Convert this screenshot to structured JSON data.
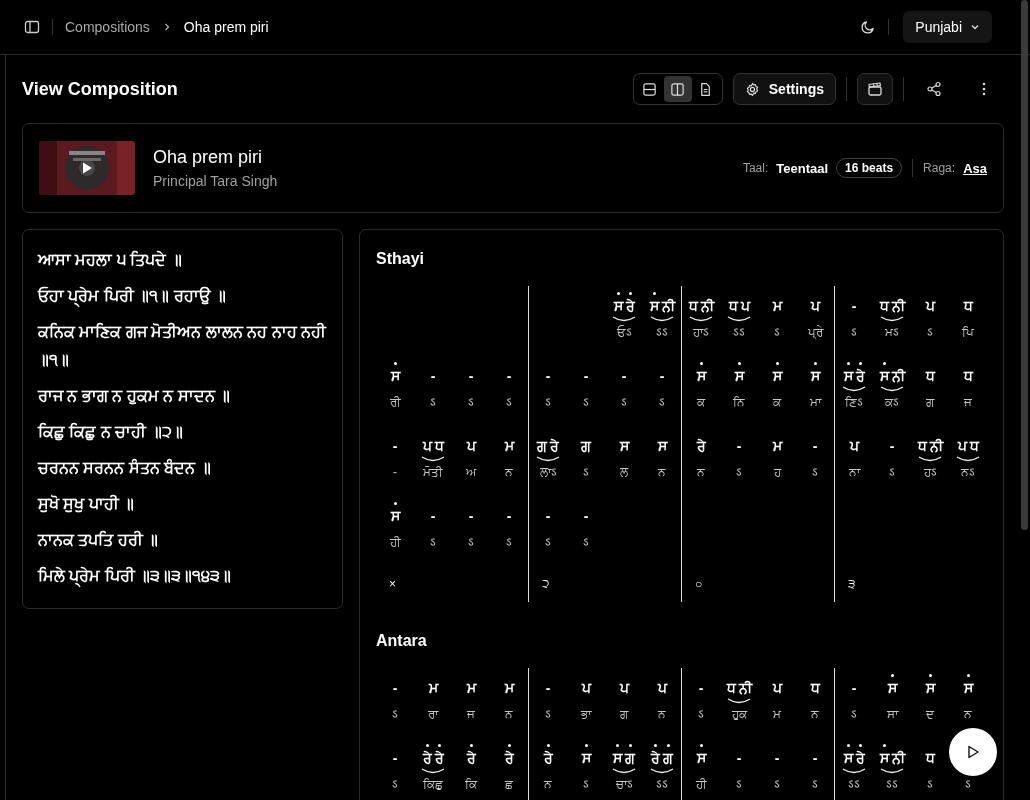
{
  "breadcrumb": [
    "Compositions",
    "Oha prem piri"
  ],
  "language": "Punjabi",
  "page_title": "View Composition",
  "view_modes": [
    {
      "kind": "rows",
      "selected": false
    },
    {
      "kind": "columns",
      "selected": true
    },
    {
      "kind": "document",
      "selected": false
    }
  ],
  "settings_label": "Settings",
  "composition": {
    "title": "Oha prem piri",
    "artist": "Principal Tara Singh",
    "taal_label": "Taal:",
    "taal": "Teentaal",
    "beats": "16 beats",
    "raga_label": "Raga:",
    "raga": "Asa"
  },
  "lyrics": [
    "ਆਸਾ ਮਹਲਾ ੫ ਤਿਪਦੇ ॥",
    "ਓਹਾ ਪ੍ਰੇਮ ਪਿਰੀ ॥੧॥ ਰਹਾਉ ॥",
    "ਕਨਿਕ ਮਾਣਿਕ ਗਜ ਮੋਤੀਅਨ ਲਾਲਨ ਨਹ ਨਾਹ ਨਹੀ ॥੧॥",
    "ਰਾਜ ਨ ਭਾਗ ਨ ਹੁਕਮ ਨ ਸਾਦਨ ॥",
    "ਕਿਛੁ ਕਿਛੁ ਨ ਚਾਹੀ ॥੨॥",
    "ਚਰਨਨ ਸਰਨਨ ਸੰਤਨ ਬੰਦਨ ॥",
    "ਸੁਖੋ ਸੁਖੁ ਪਾਹੀ ॥",
    "ਨਾਨਕ ਤਪਤਿ ਹਰੀ ॥",
    "ਮਿਲੇ ਪ੍ਰੇਮ ਪਿਰੀ ॥੩॥੩॥੧੪੩॥"
  ],
  "sections": [
    {
      "title": "Sthayi",
      "taal_marks": [
        "×",
        "੨",
        "○",
        "੩"
      ],
      "rows": [
        [
          {
            "kind": "empty"
          },
          {
            "kind": "empty"
          },
          {
            "kind": "empty"
          },
          {
            "kind": "empty"
          },
          {
            "kind": "empty"
          },
          {
            "kind": "empty"
          },
          {
            "kind": "note",
            "notes": [
              {
                "text": "ਸ",
                "upper": true
              },
              {
                "text": "ਰੇ",
                "upper": true
              }
            ],
            "lyric": "ਓऽ"
          },
          {
            "kind": "note",
            "notes": [
              {
                "text": "ਸ",
                "upper": true
              },
              {
                "text": "ਨੀ",
                "upper": false
              }
            ],
            "lyric": "ऽऽ"
          },
          {
            "kind": "note",
            "notes": [
              {
                "text": "ਧ",
                "upper": false
              },
              {
                "text": "ਨੀ",
                "upper": false
              }
            ],
            "lyric": "ਹਾऽ"
          },
          {
            "kind": "note",
            "notes": [
              {
                "text": "ਧ",
                "upper": false
              },
              {
                "text": "ਪ",
                "upper": false
              }
            ],
            "lyric": "ऽऽ"
          },
          {
            "kind": "note",
            "notes": [
              {
                "text": "ਮ",
                "upper": false
              }
            ],
            "lyric": "ऽ"
          },
          {
            "kind": "note",
            "notes": [
              {
                "text": "ਪ",
                "upper": false
              }
            ],
            "lyric": "ਪ੍ਰੇ"
          },
          {
            "kind": "note",
            "notes": [
              {
                "text": "-",
                "upper": false
              }
            ],
            "lyric": "ऽ"
          },
          {
            "kind": "note",
            "notes": [
              {
                "text": "ਧ",
                "upper": false
              },
              {
                "text": "ਨੀ",
                "upper": false
              }
            ],
            "lyric": "ਮऽ"
          },
          {
            "kind": "note",
            "notes": [
              {
                "text": "ਪ",
                "upper": false
              }
            ],
            "lyric": "ऽ"
          },
          {
            "kind": "note",
            "notes": [
              {
                "text": "ਧ",
                "upper": false
              }
            ],
            "lyric": "ਪਿ"
          }
        ],
        [
          {
            "kind": "note",
            "notes": [
              {
                "text": "ਸ",
                "upper": true
              }
            ],
            "lyric": "ਰੀ"
          },
          {
            "kind": "note",
            "notes": [
              {
                "text": "-",
                "upper": false
              }
            ],
            "lyric": "ऽ"
          },
          {
            "kind": "note",
            "notes": [
              {
                "text": "-",
                "upper": false
              }
            ],
            "lyric": "ऽ"
          },
          {
            "kind": "note",
            "notes": [
              {
                "text": "-",
                "upper": false
              }
            ],
            "lyric": "ऽ"
          },
          {
            "kind": "note",
            "notes": [
              {
                "text": "-",
                "upper": false
              }
            ],
            "lyric": "ऽ"
          },
          {
            "kind": "note",
            "notes": [
              {
                "text": "-",
                "upper": false
              }
            ],
            "lyric": "ऽ"
          },
          {
            "kind": "note",
            "notes": [
              {
                "text": "-",
                "upper": false
              }
            ],
            "lyric": "ऽ"
          },
          {
            "kind": "note",
            "notes": [
              {
                "text": "-",
                "upper": false
              }
            ],
            "lyric": "ऽ"
          },
          {
            "kind": "note",
            "notes": [
              {
                "text": "ਸ",
                "upper": true
              }
            ],
            "lyric": "ਕ"
          },
          {
            "kind": "note",
            "notes": [
              {
                "text": "ਸ",
                "upper": true
              }
            ],
            "lyric": "ਨਿ"
          },
          {
            "kind": "note",
            "notes": [
              {
                "text": "ਸ",
                "upper": true
              }
            ],
            "lyric": "ਕ"
          },
          {
            "kind": "note",
            "notes": [
              {
                "text": "ਸ",
                "upper": true
              }
            ],
            "lyric": "ਮਾ"
          },
          {
            "kind": "note",
            "notes": [
              {
                "text": "ਸ",
                "upper": true
              },
              {
                "text": "ਰੇ",
                "upper": true
              }
            ],
            "lyric": "ਣਿऽ"
          },
          {
            "kind": "note",
            "notes": [
              {
                "text": "ਸ",
                "upper": true
              },
              {
                "text": "ਨੀ",
                "upper": false
              }
            ],
            "lyric": "ਕऽ"
          },
          {
            "kind": "note",
            "notes": [
              {
                "text": "ਧ",
                "upper": false
              }
            ],
            "lyric": "ਗ"
          },
          {
            "kind": "note",
            "notes": [
              {
                "text": "ਧ",
                "upper": false
              }
            ],
            "lyric": "ਜ"
          }
        ],
        [
          {
            "kind": "note",
            "notes": [
              {
                "text": "-",
                "upper": false
              }
            ],
            "lyric": "-"
          },
          {
            "kind": "note",
            "notes": [
              {
                "text": "ਪ",
                "upper": false
              },
              {
                "text": "ਧ",
                "upper": false
              }
            ],
            "lyric": "ਮੋਤੀ"
          },
          {
            "kind": "note",
            "notes": [
              {
                "text": "ਪ",
                "upper": false
              }
            ],
            "lyric": "ਅ"
          },
          {
            "kind": "note",
            "notes": [
              {
                "text": "ਮ",
                "upper": false
              }
            ],
            "lyric": "ਨ"
          },
          {
            "kind": "note",
            "notes": [
              {
                "text": "ਗ",
                "upper": false
              },
              {
                "text": "ਰੇ",
                "upper": false
              }
            ],
            "lyric": "ਲਾऽ"
          },
          {
            "kind": "note",
            "notes": [
              {
                "text": "ਗ",
                "upper": false
              }
            ],
            "lyric": "ऽ"
          },
          {
            "kind": "note",
            "notes": [
              {
                "text": "ਸ",
                "upper": false
              }
            ],
            "lyric": "ਲ"
          },
          {
            "kind": "note",
            "notes": [
              {
                "text": "ਸ",
                "upper": false
              }
            ],
            "lyric": "ਨ"
          },
          {
            "kind": "note",
            "notes": [
              {
                "text": "ਰੇ",
                "upper": false
              }
            ],
            "lyric": "ਨ"
          },
          {
            "kind": "note",
            "notes": [
              {
                "text": "-",
                "upper": false
              }
            ],
            "lyric": "ऽ"
          },
          {
            "kind": "note",
            "notes": [
              {
                "text": "ਮ",
                "upper": false
              }
            ],
            "lyric": "ਹ"
          },
          {
            "kind": "note",
            "notes": [
              {
                "text": "-",
                "upper": false
              }
            ],
            "lyric": "ऽ"
          },
          {
            "kind": "note",
            "notes": [
              {
                "text": "ਪ",
                "upper": false
              }
            ],
            "lyric": "ਨਾ"
          },
          {
            "kind": "note",
            "notes": [
              {
                "text": "-",
                "upper": false
              }
            ],
            "lyric": "ऽ"
          },
          {
            "kind": "note",
            "notes": [
              {
                "text": "ਧ",
                "upper": false
              },
              {
                "text": "ਨੀ",
                "upper": false
              }
            ],
            "lyric": "ਹऽ"
          },
          {
            "kind": "note",
            "notes": [
              {
                "text": "ਪ",
                "upper": false
              },
              {
                "text": "ਧ",
                "upper": false
              }
            ],
            "lyric": "ਨऽ"
          }
        ],
        [
          {
            "kind": "note",
            "notes": [
              {
                "text": "ਸ",
                "upper": true
              }
            ],
            "lyric": "ਹੀ"
          },
          {
            "kind": "note",
            "notes": [
              {
                "text": "-",
                "upper": false
              }
            ],
            "lyric": "ऽ"
          },
          {
            "kind": "note",
            "notes": [
              {
                "text": "-",
                "upper": false
              }
            ],
            "lyric": "ऽ"
          },
          {
            "kind": "note",
            "notes": [
              {
                "text": "-",
                "upper": false
              }
            ],
            "lyric": "ऽ"
          },
          {
            "kind": "note",
            "notes": [
              {
                "text": "-",
                "upper": false
              }
            ],
            "lyric": "ऽ"
          },
          {
            "kind": "note",
            "notes": [
              {
                "text": "-",
                "upper": false
              }
            ],
            "lyric": "ऽ"
          }
        ]
      ]
    },
    {
      "title": "Antara",
      "rows": [
        [
          {
            "kind": "note",
            "notes": [
              {
                "text": "-",
                "upper": false
              }
            ],
            "lyric": "ऽ"
          },
          {
            "kind": "note",
            "notes": [
              {
                "text": "ਮ",
                "upper": false
              }
            ],
            "lyric": "ਰਾ"
          },
          {
            "kind": "note",
            "notes": [
              {
                "text": "ਮ",
                "upper": false
              }
            ],
            "lyric": "ਜ"
          },
          {
            "kind": "note",
            "notes": [
              {
                "text": "ਮ",
                "upper": false
              }
            ],
            "lyric": "ਨ"
          },
          {
            "kind": "note",
            "notes": [
              {
                "text": "-",
                "upper": false
              }
            ],
            "lyric": "ऽ"
          },
          {
            "kind": "note",
            "notes": [
              {
                "text": "ਪ",
                "upper": false
              }
            ],
            "lyric": "ਭਾ"
          },
          {
            "kind": "note",
            "notes": [
              {
                "text": "ਪ",
                "upper": false
              }
            ],
            "lyric": "ਗ"
          },
          {
            "kind": "note",
            "notes": [
              {
                "text": "ਪ",
                "upper": false
              }
            ],
            "lyric": "ਨ"
          },
          {
            "kind": "note",
            "notes": [
              {
                "text": "-",
                "upper": false
              }
            ],
            "lyric": "ऽ"
          },
          {
            "kind": "note",
            "notes": [
              {
                "text": "ਧ",
                "upper": false
              },
              {
                "text": "ਨੀ",
                "upper": false
              }
            ],
            "lyric": "ਹੁਕ"
          },
          {
            "kind": "note",
            "notes": [
              {
                "text": "ਪ",
                "upper": false
              }
            ],
            "lyric": "ਮ"
          },
          {
            "kind": "note",
            "notes": [
              {
                "text": "ਧ",
                "upper": false
              }
            ],
            "lyric": "ਨ"
          },
          {
            "kind": "note",
            "notes": [
              {
                "text": "-",
                "upper": false
              }
            ],
            "lyric": "ऽ"
          },
          {
            "kind": "note",
            "notes": [
              {
                "text": "ਸ",
                "upper": true
              }
            ],
            "lyric": "ਸਾ"
          },
          {
            "kind": "note",
            "notes": [
              {
                "text": "ਸ",
                "upper": true
              }
            ],
            "lyric": "ਦ"
          },
          {
            "kind": "note",
            "notes": [
              {
                "text": "ਸ",
                "upper": true
              }
            ],
            "lyric": "ਨ"
          }
        ],
        [
          {
            "kind": "note",
            "notes": [
              {
                "text": "-",
                "upper": false
              }
            ],
            "lyric": "ऽ"
          },
          {
            "kind": "note",
            "notes": [
              {
                "text": "ਰੇ",
                "upper": true
              },
              {
                "text": "ਰੇ",
                "upper": true
              }
            ],
            "lyric": "ਕਿਛੁ"
          },
          {
            "kind": "note",
            "notes": [
              {
                "text": "ਰੇ",
                "upper": true
              }
            ],
            "lyric": "ਕਿ"
          },
          {
            "kind": "note",
            "notes": [
              {
                "text": "ਰੇ",
                "upper": true
              }
            ],
            "lyric": "ਛ"
          },
          {
            "kind": "note",
            "notes": [
              {
                "text": "ਰੇ",
                "upper": true
              }
            ],
            "lyric": "ਨ"
          },
          {
            "kind": "note",
            "notes": [
              {
                "text": "ਸ",
                "upper": true
              }
            ],
            "lyric": "ऽ"
          },
          {
            "kind": "note",
            "notes": [
              {
                "text": "ਸ",
                "upper": true
              },
              {
                "text": "ਗ",
                "upper": true
              }
            ],
            "lyric": "ਚਾऽ"
          },
          {
            "kind": "note",
            "notes": [
              {
                "text": "ਰੇ",
                "upper": true
              },
              {
                "text": "ਗ",
                "upper": true
              }
            ],
            "lyric": "ऽऽ"
          },
          {
            "kind": "note",
            "notes": [
              {
                "text": "ਸ",
                "upper": true
              }
            ],
            "lyric": "ਹੀ"
          },
          {
            "kind": "note",
            "notes": [
              {
                "text": "-",
                "upper": false
              }
            ],
            "lyric": "ऽ"
          },
          {
            "kind": "note",
            "notes": [
              {
                "text": "-",
                "upper": false
              }
            ],
            "lyric": "ऽ"
          },
          {
            "kind": "note",
            "notes": [
              {
                "text": "-",
                "upper": false
              }
            ],
            "lyric": "ऽ"
          },
          {
            "kind": "note",
            "notes": [
              {
                "text": "ਸ",
                "upper": true
              },
              {
                "text": "ਰੇ",
                "upper": true
              }
            ],
            "lyric": "ऽऽ"
          },
          {
            "kind": "note",
            "notes": [
              {
                "text": "ਸ",
                "upper": true
              },
              {
                "text": "ਨੀ",
                "upper": false
              }
            ],
            "lyric": "ऽऽ"
          },
          {
            "kind": "note",
            "notes": [
              {
                "text": "ਧ",
                "upper": false
              }
            ],
            "lyric": "ऽ"
          },
          {
            "kind": "note",
            "lyric": "ऽ"
          }
        ]
      ]
    }
  ]
}
